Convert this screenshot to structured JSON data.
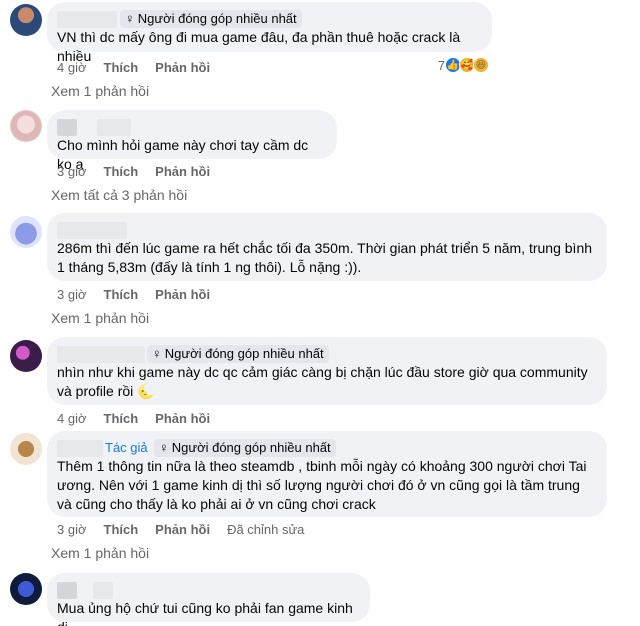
{
  "comments": [
    {
      "badge": "Người đóng góp nhiều nhất",
      "text": "VN thì dc mấy ông đi mua game đâu, đa phần thuê hoặc crack là nhiều",
      "time": "4 giờ",
      "like": "Thích",
      "reply": "Phản hồi",
      "reaction_count": "7",
      "view_replies": "Xem 1 phản hồi"
    },
    {
      "text": "Cho mình hỏi game này chơi tay cầm dc ko ạ",
      "time": "3 giờ",
      "like": "Thích",
      "reply": "Phản hồi",
      "view_replies": "Xem tất cả 3 phản hồi"
    },
    {
      "text": "286m thì đến lúc game ra hết chắc tối đa 350m. Thời gian phát triển 5 năm, trung bình 1 tháng 5,83m (đấy là tính 1 ng thôi). Lỗ nặng :)).",
      "time": "3 giờ",
      "like": "Thích",
      "reply": "Phản hồi",
      "view_replies": "Xem 1 phản hồi"
    },
    {
      "badge": "Người đóng góp nhiều nhất",
      "text": "nhìn như khi game này dc qc cảm giác càng bị chặn lúc đầu store giờ qua community và profile rồi",
      "emoji": "🌜",
      "time": "4 giờ",
      "like": "Thích",
      "reply": "Phản hồi"
    },
    {
      "author_label": "Tác giả",
      "badge": "Người đóng góp nhiều nhất",
      "text": "Thêm 1 thông tin nữa là theo steamdb , tbinh mỗi ngày có khoảng 300 người chơi Tai ương. Nên với 1 game kinh dị thì số lượng người chơi đó ở vn cũng gọi là tầm trung và cũng cho thấy là ko phải ai ở vn cũng chơi crack",
      "time": "3 giờ",
      "like": "Thích",
      "reply": "Phản hồi",
      "edited": "Đã chỉnh sửa",
      "view_replies": "Xem 1 phản hồi"
    },
    {
      "text": "Mua ủng hộ chứ tui cũng ko phải fan game kinh dị"
    }
  ],
  "colors": {
    "bubble": "#f0f2f5",
    "meta": "#65676b",
    "author": "#1877f2"
  },
  "icons": [
    "badge-icon",
    "like-reaction-icon",
    "haha-reaction-icon",
    "care-reaction-icon"
  ]
}
